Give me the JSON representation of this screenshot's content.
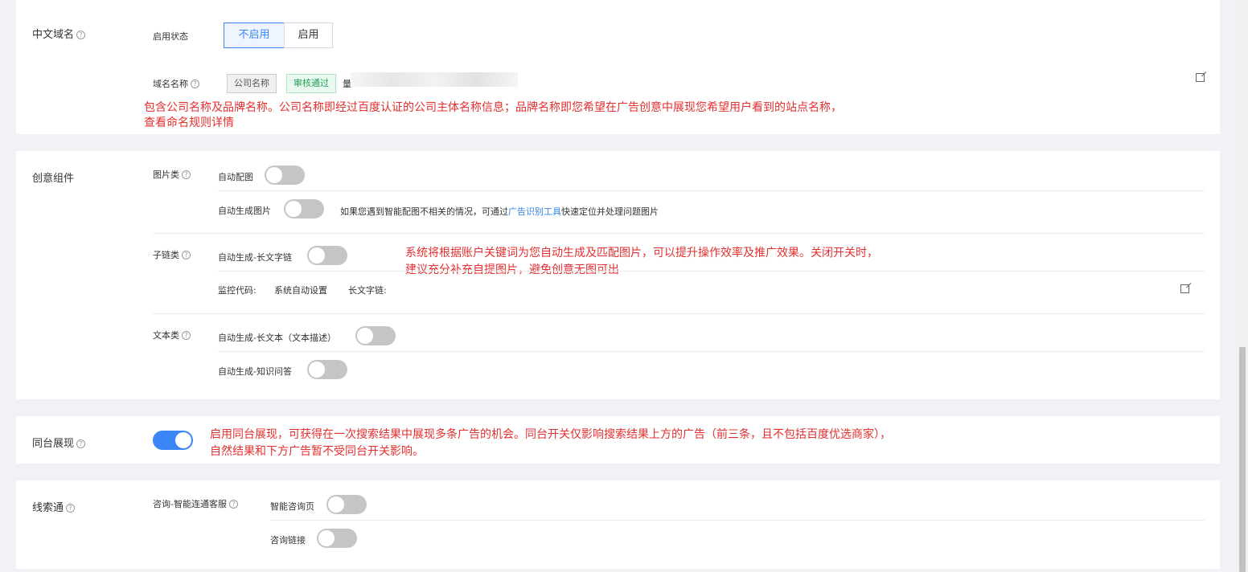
{
  "domain": {
    "section_label": "中文域名",
    "enable_label": "启用状态",
    "btn_disable": "不启用",
    "btn_enable": "启用",
    "name_label": "域名名称",
    "tag_company": "公司名称",
    "tag_status": "审核通过",
    "name_value": "量",
    "note_line1": "包含公司名称及品牌名称。公司名称即经过百度认证的公司主体名称信息；品牌名称即您希望在广告创意中展现您希望用户看到的站点名称，",
    "note_line2": "查看命名规则详情"
  },
  "creative": {
    "section_label": "创意组件",
    "image_group": "图片类",
    "auto_match_image": "自动配图",
    "auto_gen_image": "自动生成图片",
    "image_hint_prefix": "如果您遇到智能配图不相关的情况，可通过",
    "image_hint_link": "广告识别工具",
    "image_hint_suffix": "快速定位并处理问题图片",
    "sublink_group": "子链类",
    "auto_long_sublink": "自动生成-长文字链",
    "monitor_label": "监控代码:",
    "monitor_value": "系统自动设置",
    "long_link_label": "长文字链:",
    "text_group": "文本类",
    "auto_long_text": "自动生成-长文本（文本描述）",
    "auto_qa": "自动生成-知识问答",
    "note_line1": "系统将根据账户关键词为您自动生成及匹配图片，可以提升操作效率及推广效果。关闭开关时，",
    "note_line2": "建议充分补充自提图片，避免创意无图可出"
  },
  "same_stage": {
    "section_label": "同台展现",
    "enabled": true,
    "note_line1": "启用同台展现，可获得在一次搜索结果中展现多条广告的机会。同台开关仅影响搜索结果上方的广告（前三条，且不包括百度优选商家），",
    "note_line2": "自然结果和下方广告暂不受同台开关影响。"
  },
  "leads": {
    "section_label": "线索通",
    "consult_group": "咨询-智能连通客服",
    "smart_page": "智能咨询页",
    "consult_link": "咨询链接"
  },
  "colors": {
    "accent": "#3a86f7",
    "annotation": "#e42f2f",
    "tag_green": "#1fa155",
    "link": "#2f84e6"
  }
}
